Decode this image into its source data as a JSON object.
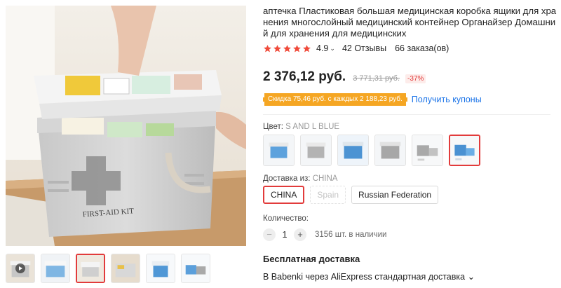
{
  "product": {
    "title": "аптечка Пластиковая большая медицинская коробка ящики для хранения многослойный медицинский контейнер Органайзер Домашний для хранения для медицинских",
    "rating": "4.9",
    "reviews": "42 Отзывы",
    "orders": "66 заказа(ов)",
    "star_count": 5,
    "star_color": "#f04a3a"
  },
  "image_text": "FIRST-AID KIT",
  "price": {
    "current": "2 376,12 руб.",
    "old": "3 771,31 руб.",
    "discount": "-37%"
  },
  "coupon": {
    "tag": "Скидка 75,46 руб. с каждых 2 188,23 руб.",
    "link": "Получить купоны"
  },
  "color": {
    "label": "Цвет:",
    "value": "S AND L BLUE",
    "selected_index": 5,
    "options": [
      "blue-box",
      "gray-box",
      "blue-box",
      "gray-box",
      "gray-set",
      "blue-set"
    ]
  },
  "shipping_from": {
    "label": "Доставка из:",
    "value": "CHINA",
    "options": [
      "CHINA",
      "Spain",
      "Russian Federation"
    ],
    "selected_index": 0,
    "disabled_index": 1
  },
  "quantity": {
    "label": "Количество:",
    "minus": "−",
    "plus": "+",
    "value": "1",
    "stock": "3156 шт. в наличии"
  },
  "delivery": {
    "title": "Бесплатная доставка",
    "detail": "В Babenki через AliExpress стандартная доставка"
  },
  "colors": {
    "accent_red": "#e23b3b",
    "coupon_orange": "#f5a623",
    "link_blue": "#1a73e8"
  }
}
